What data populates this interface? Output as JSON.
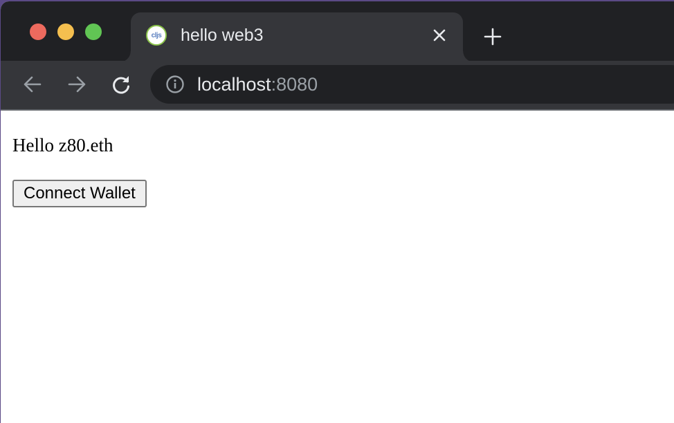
{
  "browser": {
    "tab": {
      "title": "hello web3",
      "favicon_text": "cljs"
    },
    "address": {
      "host": "localhost",
      "port": ":8080"
    }
  },
  "page": {
    "greeting": "Hello z80.eth",
    "connect_button_label": "Connect Wallet"
  },
  "colors": {
    "titlebar": "#202124",
    "toolbar": "#35363a",
    "close": "#ed6a5e",
    "minimize": "#f5bf4f",
    "maximize": "#61c554"
  }
}
